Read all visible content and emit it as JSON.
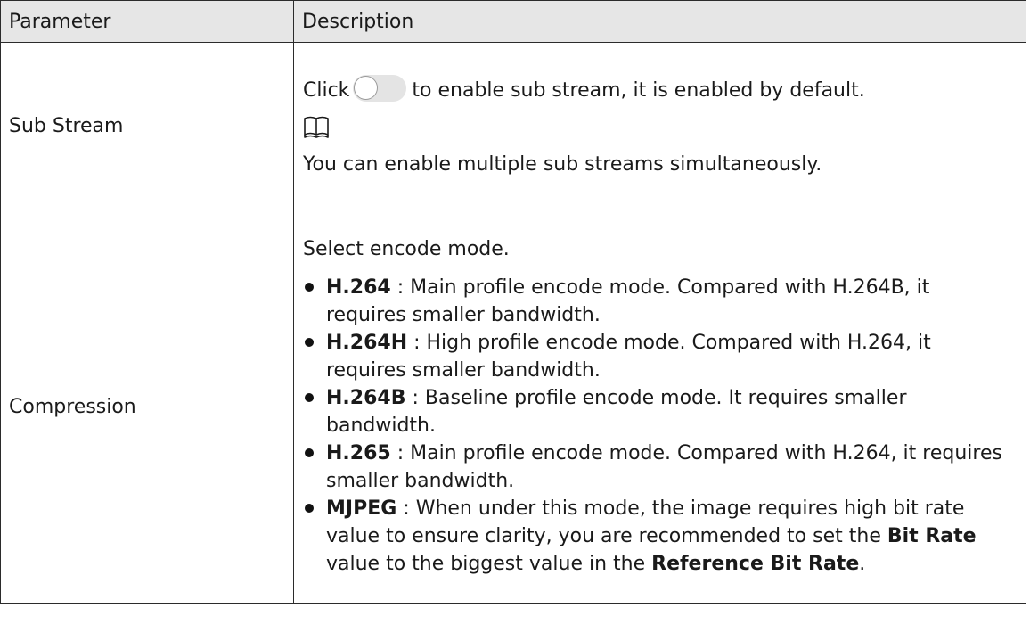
{
  "header": {
    "parameter": "Parameter",
    "description": "Description"
  },
  "rows": {
    "sub_stream": {
      "parameter": "Sub Stream",
      "click_prefix": "Click",
      "click_suffix": "to enable sub stream, it is enabled by default.",
      "note_icon": "book-note-icon",
      "note_text": "You can enable multiple sub streams simultaneously."
    },
    "compression": {
      "parameter": "Compression",
      "intro": "Select encode mode.",
      "items": [
        {
          "name": "H.264",
          "sep": " : ",
          "text": "Main profile encode mode. Compared with H.264B, it requires smaller bandwidth."
        },
        {
          "name": "H.264H",
          "sep": " : ",
          "text": "High profile encode mode. Compared with H.264, it requires smaller bandwidth."
        },
        {
          "name": "H.264B",
          "sep": " : ",
          "text": "Baseline profile encode mode. It requires smaller bandwidth."
        },
        {
          "name": "H.265",
          "sep": " : ",
          "text": "Main profile encode mode. Compared with H.264, it requires smaller bandwidth."
        },
        {
          "name": "MJPEG",
          "sep": " : ",
          "text": "When under this mode, the image requires high bit rate value to ensure clarity, you are recommended to set the ",
          "bold2": "Bit Rate",
          "text2": " value to the biggest value in the ",
          "bold3": "Reference Bit Rate",
          "text3": "."
        }
      ]
    }
  },
  "colors": {
    "header_bg": "#e6e6e6",
    "border": "#2b2b2b",
    "toggle_track": "#e4e4e4"
  }
}
